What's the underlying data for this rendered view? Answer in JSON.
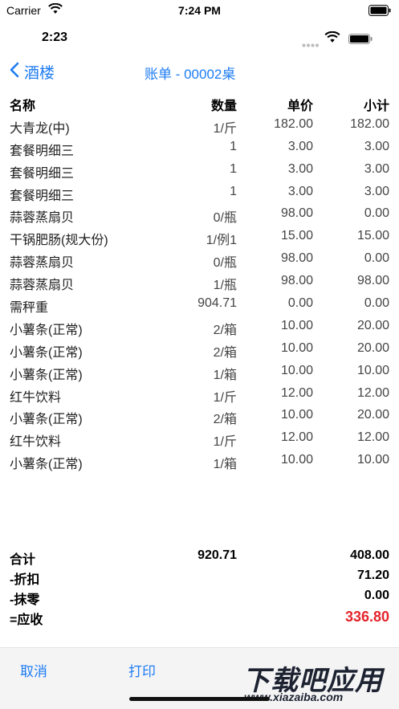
{
  "simulator_status": {
    "carrier": "Carrier",
    "time": "7:24 PM"
  },
  "app_status": {
    "time": "2:23"
  },
  "nav": {
    "back_label": "酒楼",
    "title": "账单 - 00002桌"
  },
  "table": {
    "headers": {
      "name": "名称",
      "qty": "数量",
      "price": "单价",
      "subtotal": "小计"
    },
    "rows": [
      {
        "name": "大青龙(中)",
        "qty": "1/斤",
        "price": "182.00",
        "subtotal": "182.00"
      },
      {
        "name": "套餐明细三",
        "qty": "1",
        "price": "3.00",
        "subtotal": "3.00"
      },
      {
        "name": "套餐明细三",
        "qty": "1",
        "price": "3.00",
        "subtotal": "3.00"
      },
      {
        "name": "套餐明细三",
        "qty": "1",
        "price": "3.00",
        "subtotal": "3.00"
      },
      {
        "name": "蒜蓉蒸扇贝",
        "qty": "0/瓶",
        "price": "98.00",
        "subtotal": "0.00"
      },
      {
        "name": "干锅肥肠(规大份)",
        "qty": "1/例1",
        "price": "15.00",
        "subtotal": "15.00"
      },
      {
        "name": "蒜蓉蒸扇贝",
        "qty": "0/瓶",
        "price": "98.00",
        "subtotal": "0.00"
      },
      {
        "name": "蒜蓉蒸扇贝",
        "qty": "1/瓶",
        "price": "98.00",
        "subtotal": "98.00"
      },
      {
        "name": "需秤重",
        "qty": "904.71",
        "price": "0.00",
        "subtotal": "0.00"
      },
      {
        "name": "小薯条(正常)",
        "qty": "2/箱",
        "price": "10.00",
        "subtotal": "20.00"
      },
      {
        "name": "小薯条(正常)",
        "qty": "2/箱",
        "price": "10.00",
        "subtotal": "20.00"
      },
      {
        "name": "小薯条(正常)",
        "qty": "1/箱",
        "price": "10.00",
        "subtotal": "10.00"
      },
      {
        "name": "红牛饮料",
        "qty": "1/斤",
        "price": "12.00",
        "subtotal": "12.00"
      },
      {
        "name": "小薯条(正常)",
        "qty": "2/箱",
        "price": "10.00",
        "subtotal": "20.00"
      },
      {
        "name": "红牛饮料",
        "qty": "1/斤",
        "price": "12.00",
        "subtotal": "12.00"
      },
      {
        "name": "小薯条(正常)",
        "qty": "1/箱",
        "price": "10.00",
        "subtotal": "10.00"
      }
    ]
  },
  "totals": {
    "total_label": "合计",
    "total_qty": "920.71",
    "total_amount": "408.00",
    "discount_label": "-折扣",
    "discount_amount": "71.20",
    "rounding_label": "-抹零",
    "rounding_amount": "0.00",
    "due_label": "=应收",
    "due_amount": "336.80"
  },
  "toolbar": {
    "cancel_label": "取消",
    "print_label": "打印"
  },
  "watermark": {
    "title": "下载吧应用",
    "url": "www.xiazaiba.com"
  },
  "colors": {
    "accent": "#1e7cf3",
    "due": "#e5232a"
  }
}
